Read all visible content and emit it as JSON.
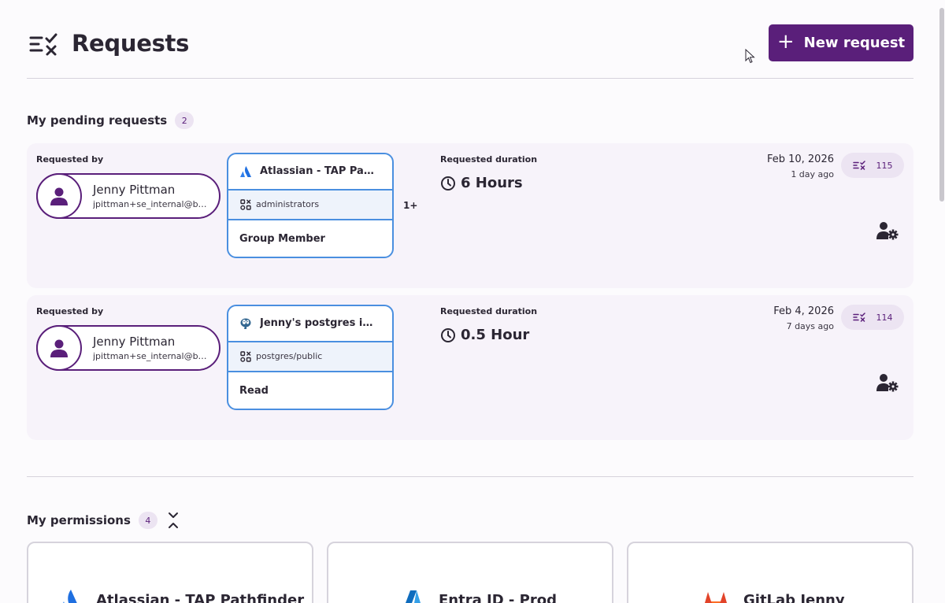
{
  "header": {
    "title": "Requests",
    "new_request_label": "New request"
  },
  "pending": {
    "title": "My pending requests",
    "count": "2",
    "requested_by_label": "Requested by",
    "duration_label": "Requested duration",
    "requests": [
      {
        "user_name": "Jenny Pittman",
        "user_email": "jpittman+se_internal@b…",
        "resource_name": "Atlassian - TAP Path…",
        "resource_icon": "atlassian-icon",
        "group": "administrators",
        "role": "Group Member",
        "more": "1+",
        "duration": "6 Hours",
        "date": "Feb 10, 2026",
        "relative": "1 day ago",
        "id": "115"
      },
      {
        "user_name": "Jenny Pittman",
        "user_email": "jpittman+se_internal@b…",
        "resource_name": "Jenny's postgres ins…",
        "resource_icon": "postgres-icon",
        "group": "postgres/public",
        "role": "Read",
        "more": "",
        "duration": "0.5 Hour",
        "date": "Feb 4, 2026",
        "relative": "7 days ago",
        "id": "114"
      }
    ]
  },
  "permissions": {
    "title": "My permissions",
    "count": "4",
    "cards": [
      {
        "name": "Atlassian - TAP Pathfinder",
        "icon": "atlassian-icon"
      },
      {
        "name": "Entra ID - Prod",
        "icon": "azure-icon"
      },
      {
        "name": "GitLab Jenny",
        "icon": "gitlab-icon"
      }
    ]
  },
  "colors": {
    "brand": "#5a1f7a",
    "resource_border": "#4a8fe0",
    "card_bg": "#f7f3fa",
    "badge_bg": "#ece4f2"
  }
}
